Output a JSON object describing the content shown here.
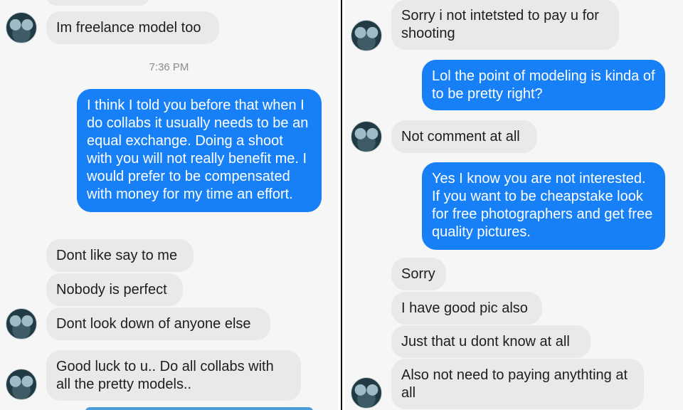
{
  "left_panel": {
    "timestamp": "7:36 PM",
    "messages": [
      {
        "text": "Im freelance model too"
      },
      {
        "text": "I think I told you before that when I do collabs it usually needs to be an equal exchange.  Doing a shoot with you will not really benefit me. I would prefer to be compensated with money for my time an effort."
      },
      {
        "text": "Dont like say to me"
      },
      {
        "text": "Nobody is perfect"
      },
      {
        "text": "Dont look down of anyone else"
      },
      {
        "text": "Good luck to u.. Do all collabs with all the pretty models.."
      }
    ]
  },
  "right_panel": {
    "messages": [
      {
        "text": "Sorry i not intetsted to pay u for shooting"
      },
      {
        "text": "Lol the point of modeling is kinda of to be pretty right?"
      },
      {
        "text": "Not comment at all"
      },
      {
        "text": "Yes I know you are not interested. If you want to be cheapstake look for free photographers and get free quality pictures."
      },
      {
        "text": "Sorry"
      },
      {
        "text": "I have good pic also"
      },
      {
        "text": "Just that u dont know at all"
      },
      {
        "text": "Also not need to paying anythting at all"
      }
    ]
  },
  "colors": {
    "outgoing_bubble": "#1780f6",
    "incoming_bubble": "#e9e9e9",
    "background": "#f6f6f6"
  }
}
